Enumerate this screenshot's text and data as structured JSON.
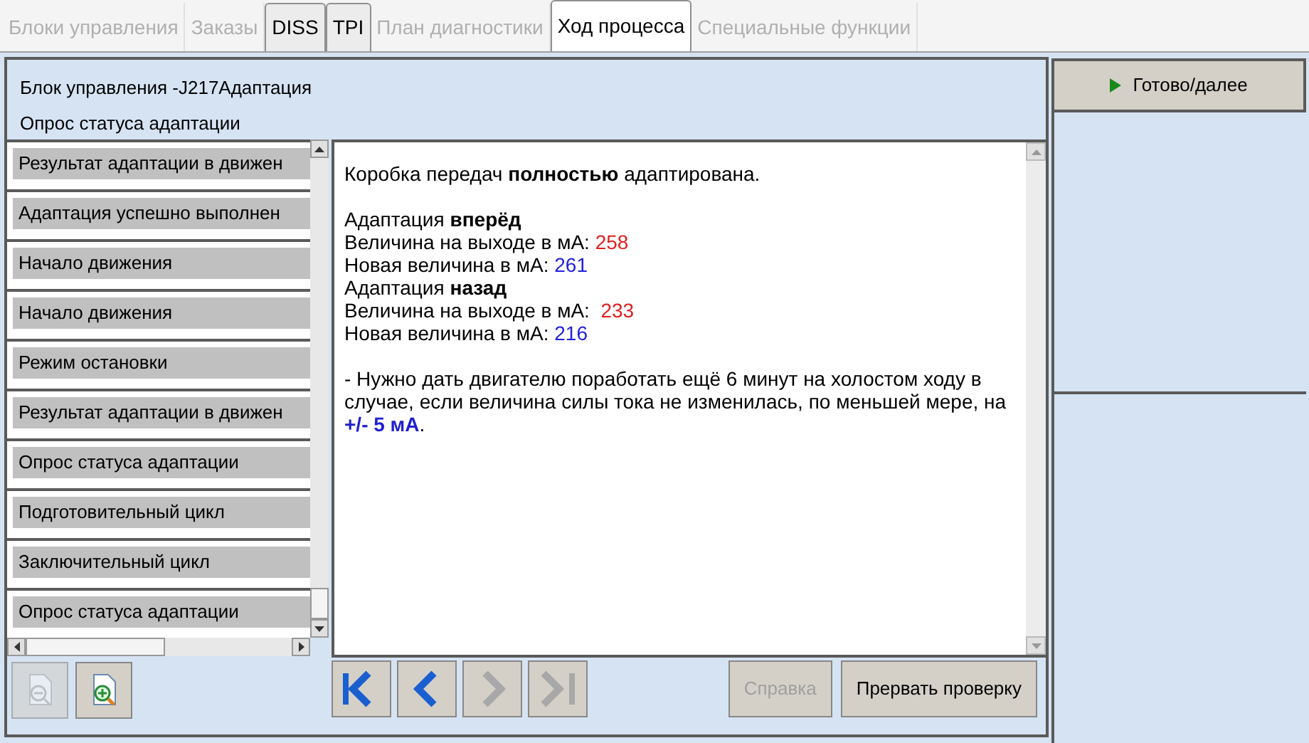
{
  "tabs": [
    {
      "label": "Блоки управления",
      "selected": false,
      "disabled": true
    },
    {
      "label": "Заказы",
      "selected": false,
      "disabled": true
    },
    {
      "label": "DISS",
      "selected": false,
      "disabled": false
    },
    {
      "label": "TPI",
      "selected": false,
      "disabled": false
    },
    {
      "label": "План диагностики",
      "selected": false,
      "disabled": true
    },
    {
      "label": "Ход процесса",
      "selected": true,
      "disabled": false
    },
    {
      "label": "Специальные функции",
      "selected": false,
      "disabled": true
    }
  ],
  "header": {
    "title": "Блок управления -J217Адаптация",
    "subtitle": "Опрос статуса адаптации"
  },
  "steps": [
    "Результат адаптации в движен",
    "Адаптация успешно выполнен",
    "Начало движения",
    "Начало движения",
    "Режим остановки",
    "Результат адаптации в движен",
    "Опрос статуса адаптации",
    "Подготовительный цикл",
    "Заключительный цикл",
    "Опрос статуса адаптации"
  ],
  "message": [
    {
      "lines": [
        {
          "kind": "text",
          "text": "Коробка передач **полностью** адаптирована."
        }
      ]
    },
    {
      "lines": [
        {
          "kind": "text",
          "text": "Адаптация **вперёд**"
        },
        {
          "kind": "reading",
          "label": "Величина на выходе в мА:",
          "value": "258",
          "color": "#e02020"
        },
        {
          "kind": "reading",
          "label": "Новая величина в мА:",
          "value": "261",
          "color": "#2020e0"
        },
        {
          "kind": "text",
          "text": "Адаптация **назад**"
        },
        {
          "kind": "reading",
          "label": "Величина на выходе в мА: ",
          "value": "233",
          "color": "#e02020"
        },
        {
          "kind": "reading",
          "label": "Новая величина в мА:",
          "value": "216",
          "color": "#2020e0"
        }
      ]
    },
    {
      "lines": [
        {
          "kind": "note",
          "text": "- Нужно дать двигателю поработать ещё 6 минут на холостом ходу в случае, если величина силы тока не изменилась, по меньшей мере, на",
          "highlight": "+/- 5 мА",
          "tail": "."
        }
      ]
    }
  ],
  "zoom_buttons": [
    {
      "kind": "zoom-out",
      "disabled": true
    },
    {
      "kind": "zoom-in",
      "disabled": false
    }
  ],
  "nav_buttons": [
    {
      "kind": "first",
      "disabled": false
    },
    {
      "kind": "prev",
      "disabled": false
    },
    {
      "kind": "next",
      "disabled": true
    },
    {
      "kind": "last",
      "disabled": true
    }
  ],
  "actions": [
    {
      "label": "Справка",
      "disabled": true
    },
    {
      "label": "Прервать проверку",
      "disabled": false
    }
  ],
  "next_button": {
    "label": "Готово/далее"
  }
}
